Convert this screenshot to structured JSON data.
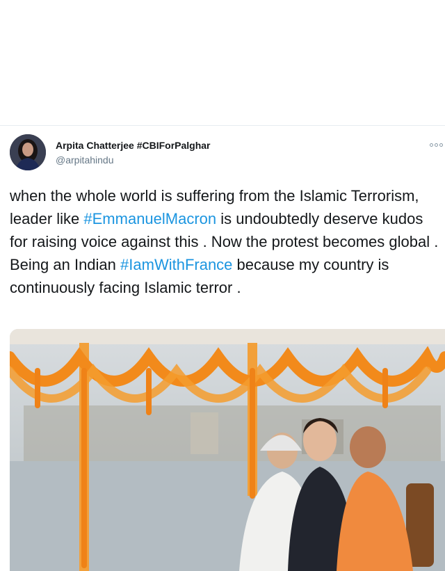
{
  "tweet": {
    "author_name": "Arpita Chatterjee #CBIForPalghar",
    "author_handle": "@arpitahindu",
    "text_part1": "when the whole world is suffering from the Islamic Terrorism, leader like ",
    "hashtag1": "#EmmanuelMacron",
    "text_part2": " is undoubtedly deserve kudos for raising voice against this . Now the protest becomes global . Being an Indian ",
    "hashtag2": "#IamWithFrance",
    "text_part3": " because my country is continuously facing Islamic terror .",
    "more_icon": "more-options-icon"
  },
  "colors": {
    "hashtag": "#1b95e0",
    "handle": "#657786",
    "text": "#14171a",
    "marigold": "#f28a1b",
    "saffron_robe": "#f08a3e"
  }
}
